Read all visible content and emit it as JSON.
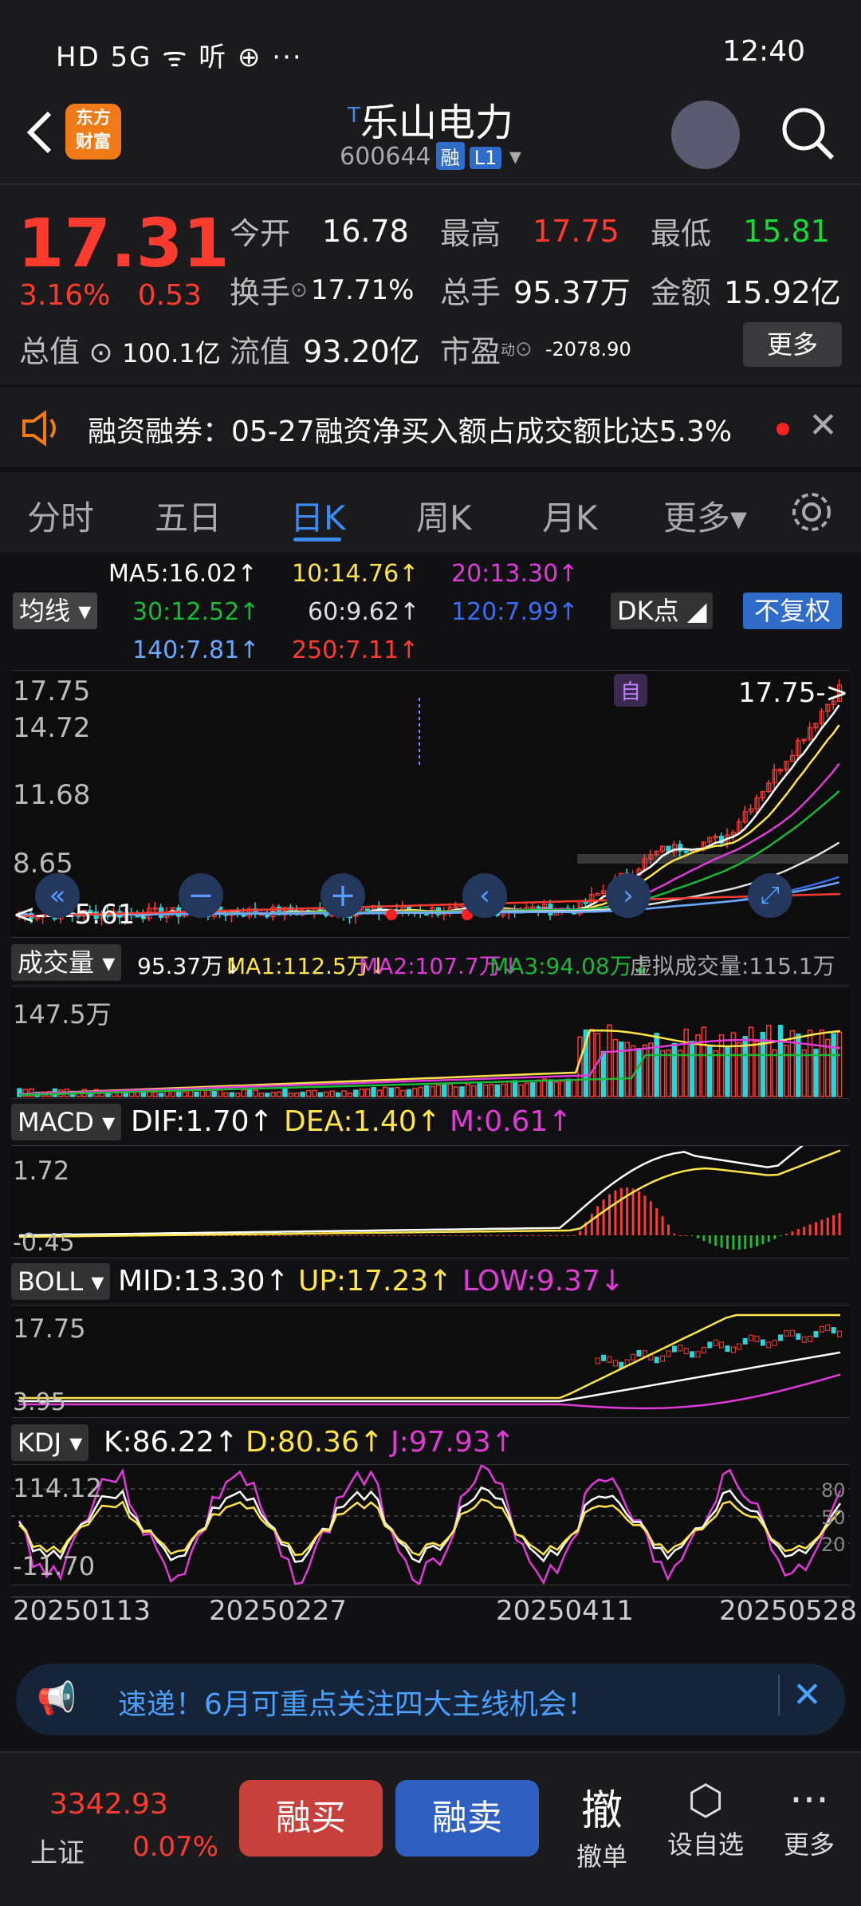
{
  "status_bar": {
    "left": "HD 5G ᯤ 听 ⊕ ···",
    "time": "12:40"
  },
  "header": {
    "title": "乐山电力",
    "title_mark": "T",
    "code": "600644",
    "tag1": "融",
    "tag2": "L1",
    "logo_text": "东方\n财富"
  },
  "quote": {
    "price": "17.31",
    "change_pct": "3.16%",
    "change": "0.53",
    "open_label": "今开",
    "open": "16.78",
    "high_label": "最高",
    "high": "17.75",
    "low_label": "最低",
    "low": "15.81",
    "turnover_label": "换手",
    "turnover": "17.71%",
    "volume_label": "总手",
    "volume": "95.37万",
    "amount_label": "金额",
    "amount": "15.92亿",
    "mcap_label": "总值",
    "mcap": "100.1亿",
    "float_label": "流值",
    "float": "93.20亿",
    "pe_label": "市盈",
    "pe_sup": "动",
    "pe": "-2078.90",
    "more": "更多"
  },
  "notice": {
    "text": "融资融券：05-27融资净买入额占成交额比达5.3%"
  },
  "tabs": [
    "分时",
    "五日",
    "日K",
    "周K",
    "月K",
    "更多▾"
  ],
  "ma_row": {
    "btn": "均线",
    "ma5": "MA5:16.02↑",
    "ma10": "10:14.76↑",
    "ma20": "20:13.30↑",
    "ma30": "30:12.52↑",
    "ma60": "60:9.62↑",
    "ma120": "120:7.99↑",
    "ma140": "140:7.81↑",
    "ma250": "250:7.11↑",
    "dk": "DK点",
    "fq": "不复权"
  },
  "kline": {
    "y1": "17.75",
    "y2": "14.72",
    "y3": "11.68",
    "y4": "8.65",
    "y5": "5.61",
    "high_tag": "17.75->",
    "self_tag": "自",
    "low_tag": "<----5.61"
  },
  "volume_row": {
    "btn": "成交量",
    "v": "95.37万↓",
    "ma1": "MA1:112.5万↓",
    "ma2": "MA2:107.7万↓",
    "ma3": "MA3:94.08万↓",
    "virtual": "虚拟成交量:115.1万",
    "y1": "147.5万"
  },
  "macd_row": {
    "btn": "MACD",
    "dif": "DIF:1.70↑",
    "dea": "DEA:1.40↑",
    "m": "M:0.61↑",
    "y1": "1.72",
    "y2": "-0.45"
  },
  "boll_row": {
    "btn": "BOLL",
    "mid": "MID:13.30↑",
    "up": "UP:17.23↑",
    "low": "LOW:9.37↓",
    "y1": "17.75",
    "y2": "3.95"
  },
  "kdj_row": {
    "btn": "KDJ",
    "k": "K:86.22↑",
    "d": "D:80.36↑",
    "j": "J:97.93↑",
    "y1": "114.12",
    "y2": "-11.70",
    "r1": "80",
    "r2": "50",
    "r3": "20"
  },
  "dates": [
    "20250113",
    "20250227",
    "20250411",
    "20250528"
  ],
  "banner": {
    "text": "速递！6月可重点关注四大主线机会！"
  },
  "bottom": {
    "index_value": "3342.93",
    "index_name": "上证",
    "index_pct": "0.07%",
    "buy": "融买",
    "sell": "融卖",
    "cancel_glyph": "撤",
    "cancel": "撤单",
    "fav": "设自选",
    "more": "更多"
  },
  "colors": {
    "up": "#ff3b30",
    "down": "#2cd3d7",
    "yellow": "#ffe44a",
    "magenta": "#e03ad8",
    "green": "#18b838",
    "blue": "#3b8df5"
  }
}
